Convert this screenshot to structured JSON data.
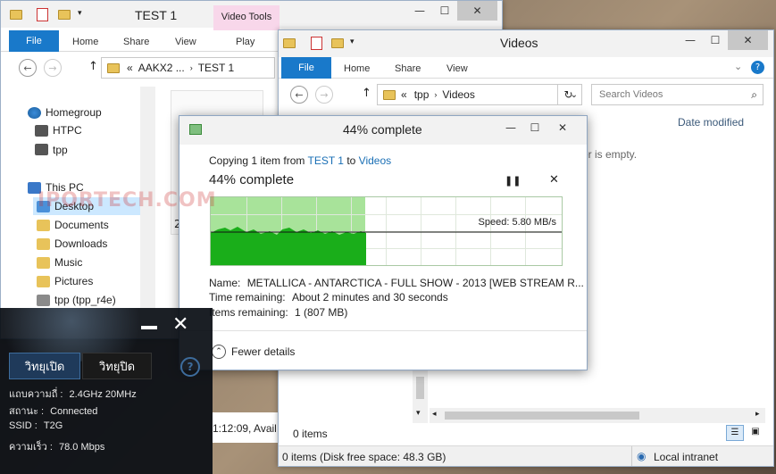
{
  "win_test1": {
    "title": "TEST 1",
    "context_tab": "Video Tools",
    "tabs": [
      "File",
      "Home",
      "Share",
      "View",
      "Play"
    ],
    "breadcrumb_prefix": "«",
    "breadcrumb": [
      "AAKX2 ...",
      "TEST 1"
    ],
    "nav": [
      "Homegroup",
      "HTPC",
      "tpp",
      "This PC",
      "Desktop",
      "Documents",
      "Downloads",
      "Music",
      "Pictures",
      "tpp (tpp_r4e)"
    ],
    "file_label": "2",
    "status_time": "1:12:09, Avail"
  },
  "win_videos": {
    "title": "Videos",
    "tabs": [
      "File",
      "Home",
      "Share",
      "View"
    ],
    "breadcrumb_prefix": "«",
    "breadcrumb": [
      "tpp",
      "Videos"
    ],
    "search_placeholder": "Search Videos",
    "col_header": "Date modified",
    "empty_text": "er is empty.",
    "items_count": "0 items",
    "status_left": "0 items (Disk free space: 48.3 GB)",
    "status_right": "Local intranet"
  },
  "copy_dialog": {
    "title": "44% complete",
    "copy_prefix": "Copying 1 item from",
    "source": "TEST 1",
    "to_word": "to",
    "dest": "Videos",
    "heading": "44% complete",
    "progress": 0.44,
    "speed_label": "Speed: 5.80 MB/s",
    "name_label": "Name:",
    "name_value": "METALLICA - ANTARCTICA - FULL SHOW - 2013 [WEB STREAM R...",
    "time_label": "Time remaining:",
    "time_value": "About 2 minutes and 30 seconds",
    "items_label": "Items remaining:",
    "items_value": "1 (807 MB)",
    "fewer_details": "Fewer details"
  },
  "wifi_widget": {
    "tab_on": "วิทยุเปิด",
    "tab_off": "วิทยุปิด",
    "rows": [
      {
        "label": "แถบความถี่ :",
        "value": "2.4GHz 20MHz"
      },
      {
        "label": "สถานะ :",
        "value": "Connected"
      },
      {
        "label": "SSID :",
        "value": "T2G"
      },
      {
        "label": "ความเร็ว :",
        "value": "78.0 Mbps"
      }
    ]
  },
  "watermark": "IPORTECH.COM",
  "colors": {
    "accent": "#1979ca",
    "progress_fill": "#a8e39a",
    "progress_graph": "#1aae1a"
  }
}
